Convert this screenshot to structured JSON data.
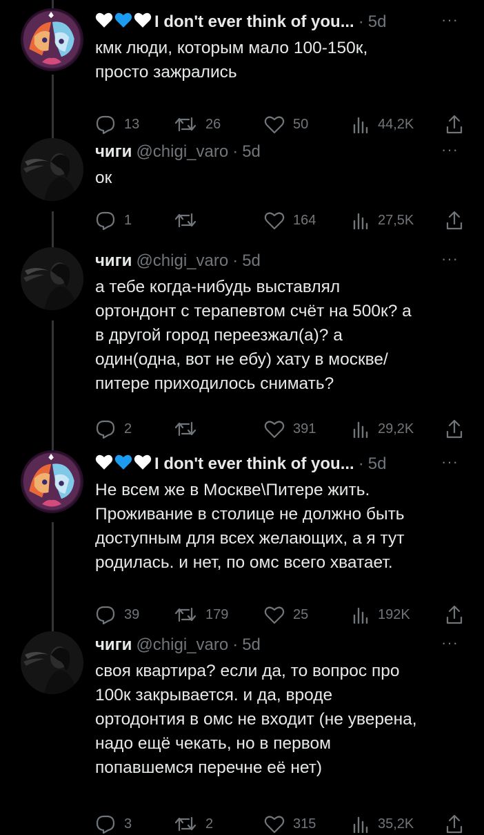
{
  "tweets": [
    {
      "kind": "pony",
      "name": "I don't ever think of you...",
      "handle": "",
      "time": "5d",
      "lines": [
        "кмк люди, которым мало 100-150к,",
        "просто зажрались"
      ],
      "replies": "13",
      "retweets": "26",
      "likes": "50",
      "views": "44,2K"
    },
    {
      "kind": "photo",
      "name": "чиги",
      "handle": "@chigi_varo",
      "time": "5d",
      "lines": [
        "ок"
      ],
      "replies": "1",
      "retweets": "",
      "likes": "164",
      "views": "27,5K"
    },
    {
      "kind": "photo",
      "name": "чиги",
      "handle": "@chigi_varo",
      "time": "5d",
      "lines": [
        "а тебе когда-нибудь выставлял",
        "ортондонт с терапевтом счёт на 500к? а",
        "в другой город переезжал(а)? а",
        "один(одна, вот не ебу) хату в москве/",
        "питере приходилось снимать?"
      ],
      "replies": "2",
      "retweets": "",
      "likes": "391",
      "views": "29,2K"
    },
    {
      "kind": "pony",
      "name": "I don't ever think of you...",
      "handle": "",
      "time": "5d",
      "lines": [
        "Не всем же в Москве\\Питере жить.",
        "Проживание в столице не должно быть",
        "доступным для всех желающих, а я тут",
        "родилась. и нет, по омс всего хватает."
      ],
      "replies": "39",
      "retweets": "179",
      "likes": "25",
      "views": "192K"
    },
    {
      "kind": "photo",
      "name": "чиги",
      "handle": "@chigi_varo",
      "time": "5d",
      "lines": [
        "своя квартира? если да, то вопрос про",
        "100к закрывается. и да, вроде",
        "ортодонтия в омс не входит (не уверена,",
        "надо ещё чекать, но в первом",
        "попавшемся перечне её нет)"
      ],
      "replies": "3",
      "retweets": "2",
      "likes": "315",
      "views": "35,2K"
    }
  ],
  "icons": {
    "heart_white": "white-heart-emoji",
    "heart_blue": "blue-heart-emoji",
    "reply": "reply-icon",
    "retweet": "retweet-icon",
    "like": "like-icon",
    "views": "views-icon",
    "share": "share-icon",
    "more": "more-icon"
  },
  "colors": {
    "background": "#000000",
    "text": "#e7e9ea",
    "muted": "#71767b",
    "thread_line": "#333639",
    "heart_blue": "#1d9bf0"
  }
}
